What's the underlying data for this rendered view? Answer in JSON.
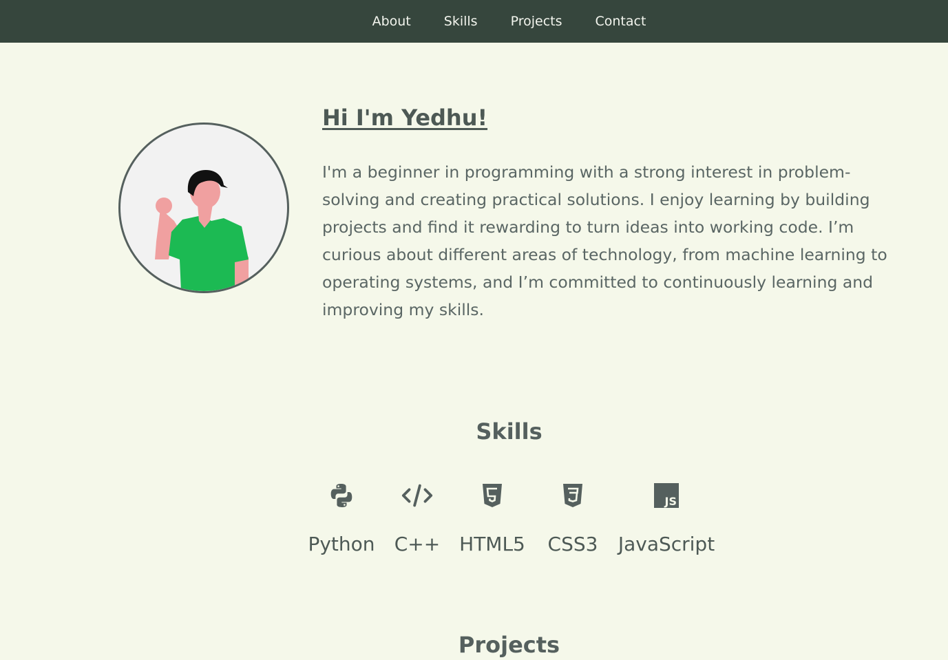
{
  "nav": {
    "items": [
      {
        "label": "About"
      },
      {
        "label": "Skills"
      },
      {
        "label": "Projects"
      },
      {
        "label": "Contact"
      }
    ]
  },
  "hero": {
    "title": "Hi I'm Yedhu!",
    "description": "I'm a beginner in programming with a strong interest in problem-solving and creating practical solutions. I enjoy learning by building projects and find it rewarding to turn ideas into working code. I’m curious about different areas of technology, from machine learning to operating systems, and I’m committed to continuously learning and improving my skills."
  },
  "skills": {
    "title": "Skills",
    "items": [
      {
        "label": "Python",
        "icon": "python-icon"
      },
      {
        "label": "C++",
        "icon": "code-icon"
      },
      {
        "label": "HTML5",
        "icon": "html5-icon"
      },
      {
        "label": "CSS3",
        "icon": "css3-icon"
      },
      {
        "label": "JavaScript",
        "icon": "javascript-icon"
      }
    ]
  },
  "projects": {
    "title": "Projects"
  },
  "colors": {
    "nav_bg": "#36463d",
    "page_bg": "#f5f8ea",
    "text": "#55605e",
    "shirt": "#1cba53",
    "skin": "#f0a0a0"
  }
}
